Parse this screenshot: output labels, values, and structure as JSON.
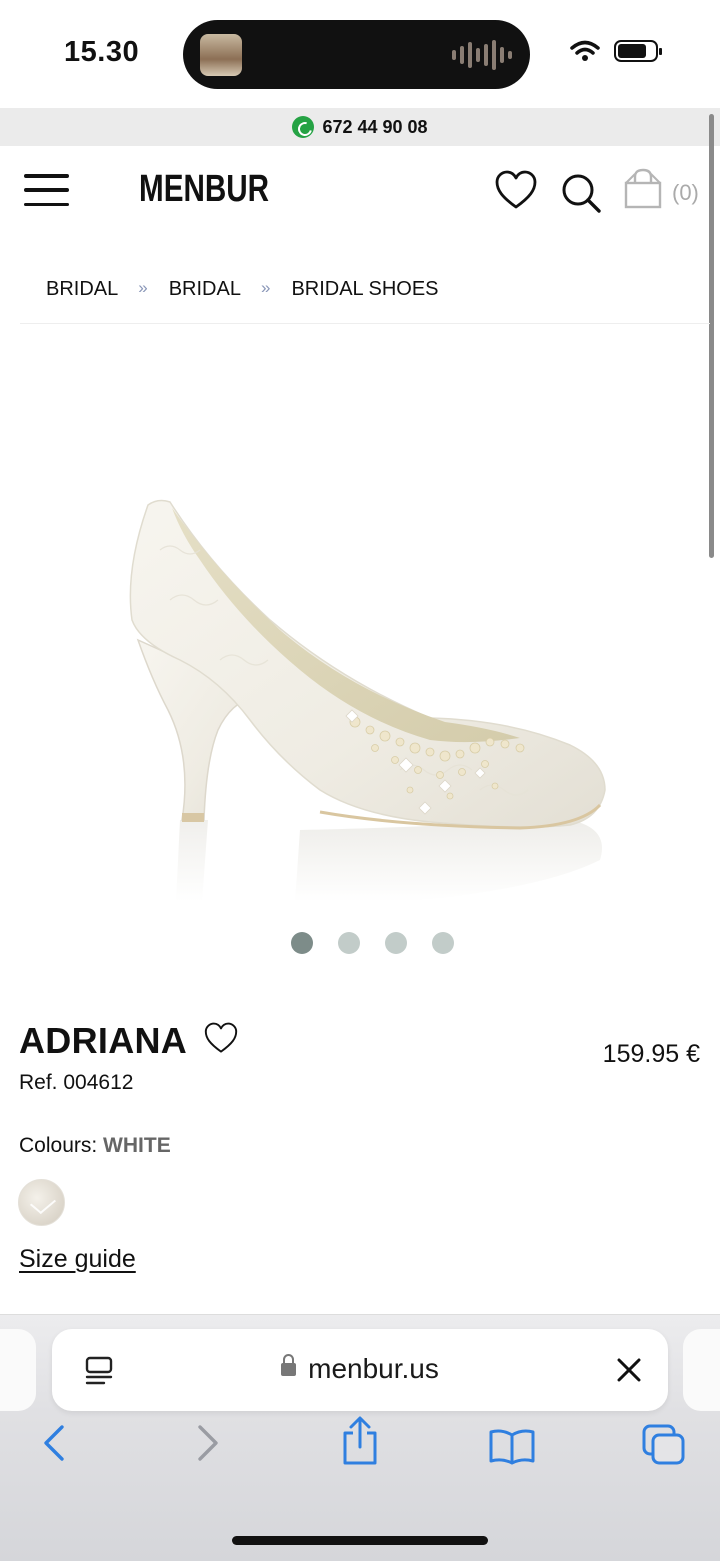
{
  "status_bar": {
    "time": "15.30"
  },
  "promo": {
    "phone": "672 44 90 08"
  },
  "header": {
    "logo": "MENBUR",
    "cart_count": "(0)"
  },
  "breadcrumb": {
    "items": [
      "BRIDAL",
      "BRIDAL",
      "BRIDAL SHOES"
    ],
    "separator": "»"
  },
  "product": {
    "name": "ADRIANA",
    "ref": "Ref. 004612",
    "price": "159.95 €",
    "colours_label": "Colours:",
    "colour_value": "WHITE",
    "size_guide_label": "Size guide",
    "carousel": {
      "total": 4,
      "active_index": 0
    }
  },
  "browser": {
    "url": "menbur.us"
  },
  "colors": {
    "accent_blue": "#2f7fe0",
    "dot_active": "#7d8c89",
    "dot_inactive": "#c2ccc9",
    "whatsapp": "#25a244"
  },
  "icons": {
    "menu": "hamburger-icon",
    "wishlist": "heart-icon",
    "search": "search-icon",
    "cart": "bag-icon",
    "whatsapp": "whatsapp-icon",
    "reader": "reader-mode-icon",
    "clear": "close-icon",
    "back": "chevron-left-icon",
    "forward": "chevron-right-icon",
    "share": "share-icon",
    "bookmarks": "book-icon",
    "tabs": "tabs-icon"
  }
}
